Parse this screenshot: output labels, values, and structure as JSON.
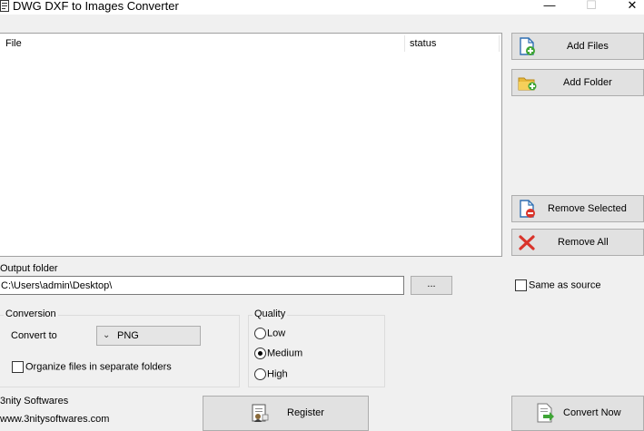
{
  "window": {
    "title": "DWG DXF to Images Converter",
    "minimize_icon": "minimize-icon",
    "maximize_icon": "maximize-icon",
    "close_icon": "close-icon"
  },
  "file_list": {
    "columns": [
      "File",
      "status"
    ],
    "rows": []
  },
  "side_buttons": {
    "add_files": "Add Files",
    "add_folder": "Add Folder",
    "remove_selected": "Remove Selected",
    "remove_all": "Remove All"
  },
  "output": {
    "label": "Output folder",
    "path": "C:\\Users\\admin\\Desktop\\",
    "browse_label": "...",
    "same_as_source_label": "Same as source",
    "same_as_source_checked": false
  },
  "conversion": {
    "group_title": "Conversion",
    "convert_to_label": "Convert to",
    "format_selected": "PNG",
    "organize_label": "Organize files in separate folders",
    "organize_checked": false
  },
  "quality": {
    "group_title": "Quality",
    "options": [
      "Low",
      "Medium",
      "High"
    ],
    "selected": "Medium"
  },
  "footer": {
    "company": "3nity Softwares",
    "website": "www.3nitysoftwares.com",
    "register_label": "Register",
    "convert_label": "Convert Now"
  },
  "colors": {
    "window_bg": "#f0f0f0",
    "button_bg": "#e1e1e1",
    "button_border": "#adadad",
    "list_bg": "#ffffff",
    "add_green": "#3fa536",
    "remove_red": "#d9342b",
    "folder_yellow": "#e8b83a",
    "icon_blue": "#2f6fb3"
  }
}
